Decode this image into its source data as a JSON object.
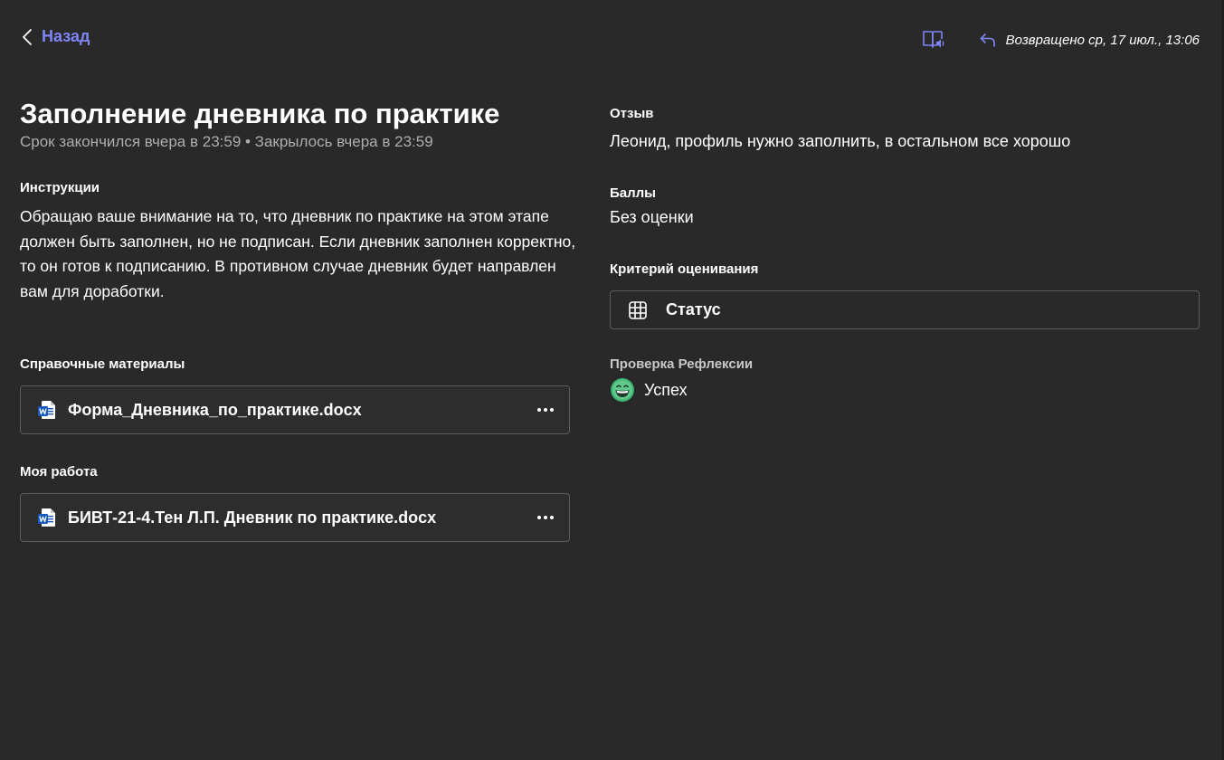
{
  "accent_color": "#7f85f5",
  "header": {
    "back_label": "Назад",
    "reader_icon": "immersive-reader-icon",
    "returned_icon": "return-arrow-icon",
    "returned_text": "Возвращено ср, 17 июл., 13:06"
  },
  "assignment": {
    "title": "Заполнение дневника по практике",
    "due_text": "Срок закончился вчера в 23:59 • Закрылось вчера в 23:59",
    "instructions_label": "Инструкции",
    "instructions_text": "Обращаю ваше внимание на то, что дневник по практике на этом этапе должен быть заполнен, но не подписан. Если дневник заполнен корректно, то он готов к подписанию. В противном случае дневник будет направлен вам для доработки.",
    "reference_label": "Справочные материалы",
    "reference_file": "Форма_Дневника_по_практике.docx",
    "my_work_label": "Моя работа",
    "my_work_file": "БИВТ-21-4.Тен Л.П. Дневник по практике.docx"
  },
  "feedback": {
    "label": "Отзыв",
    "text": "Леонид, профиль нужно заполнить, в остальном все хорошо"
  },
  "points": {
    "label": "Баллы",
    "value": "Без оценки"
  },
  "rubric": {
    "label": "Критерий оценивания",
    "name": "Статус",
    "icon": "grid-icon"
  },
  "reflection": {
    "label": "Проверка Рефлексии",
    "value": "Успех",
    "icon": "grinning-face-icon"
  }
}
